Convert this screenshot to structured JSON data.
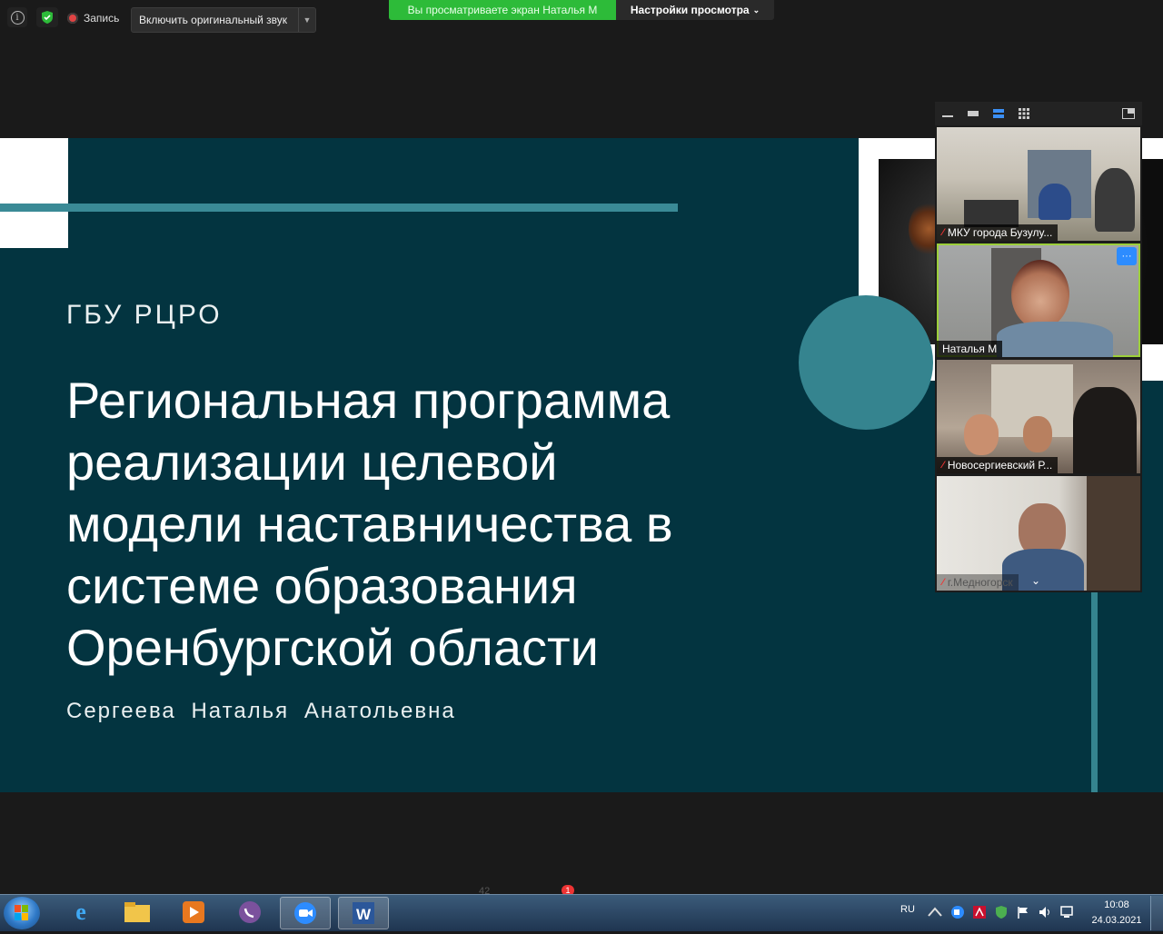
{
  "zoom_top": {
    "record_label": "Запись",
    "original_sound_label": "Включить оригинальный звук",
    "viewing_banner": "Вы просматриваете экран Наталья М",
    "view_settings_label": "Настройки просмотра"
  },
  "slide": {
    "organization": "ГБУ РЦРО",
    "title_lines": [
      "Региональная программа",
      "реализации целевой",
      "модели наставничества в",
      "системе образования",
      "Оренбургской области"
    ],
    "author": "Сергеева Наталья Анатольевна"
  },
  "gallery": {
    "participants": [
      {
        "name": "МКУ города Бузулу...",
        "muted": true
      },
      {
        "name": "Наталья М",
        "muted": false,
        "active_speaker": true
      },
      {
        "name": "Новосергиевский Р...",
        "muted": true
      },
      {
        "name": "г.Медногорск",
        "muted": true
      }
    ],
    "more_button": "···"
  },
  "toolbar": {
    "participants_count": "42",
    "chat_badge": "1"
  },
  "taskbar": {
    "language": "RU",
    "time": "10:08",
    "date": "24.03.2021"
  },
  "colors": {
    "slide_bg": "#033440",
    "accent_teal": "#35848f",
    "banner_green": "#2dbb39"
  }
}
